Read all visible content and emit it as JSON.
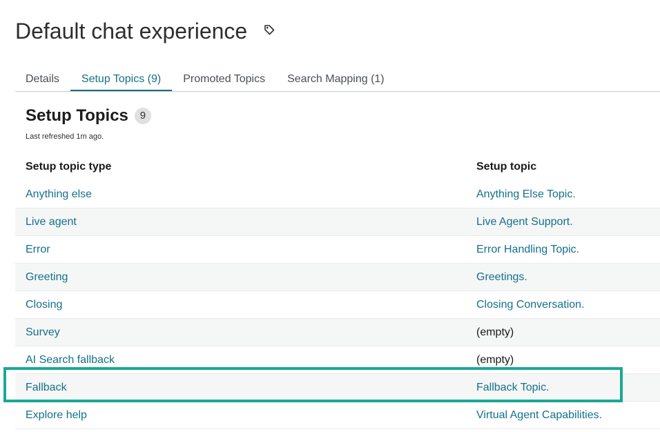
{
  "page": {
    "title": "Default chat experience",
    "tag_icon": "tag-icon"
  },
  "tabs": [
    {
      "label": "Details",
      "active": false
    },
    {
      "label": "Setup Topics (9)",
      "active": true
    },
    {
      "label": "Promoted Topics",
      "active": false
    },
    {
      "label": "Search Mapping (1)",
      "active": false
    }
  ],
  "section": {
    "title": "Setup Topics",
    "count": "9",
    "refresh": "Last refreshed 1m ago."
  },
  "table": {
    "headers": {
      "type": "Setup topic type",
      "topic": "Setup topic"
    },
    "rows": [
      {
        "type": "Anything else",
        "topic": "Anything Else Topic."
      },
      {
        "type": "Live agent",
        "topic": "Live Agent Support."
      },
      {
        "type": "Error",
        "topic": "Error Handling Topic."
      },
      {
        "type": "Greeting",
        "topic": "Greetings."
      },
      {
        "type": "Closing",
        "topic": "Closing Conversation."
      },
      {
        "type": "Survey",
        "topic": "(empty)"
      },
      {
        "type": "AI Search fallback",
        "topic": "(empty)"
      },
      {
        "type": "Fallback",
        "topic": "Fallback Topic."
      },
      {
        "type": "Explore help",
        "topic": "Virtual Agent Capabilities."
      }
    ]
  },
  "colors": {
    "link": "#14708a",
    "highlight": "#1aa896"
  }
}
